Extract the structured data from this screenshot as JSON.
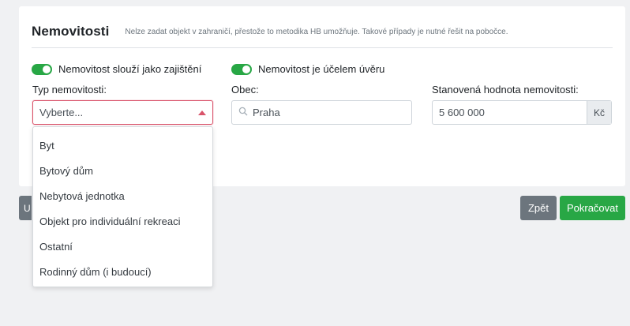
{
  "card": {
    "title": "Nemovitosti",
    "note": "Nelze zadat objekt v zahraničí, přestože to metodika HB umožňuje. Takové případy je nutné řešit na pobočce."
  },
  "toggles": [
    {
      "label": "Nemovitost slouží jako zajištění",
      "on": true
    },
    {
      "label": "Nemovitost je účelem úvěru",
      "on": true
    }
  ],
  "fields": {
    "type": {
      "label": "Typ nemovitosti:",
      "value": "Vyberte..."
    },
    "city": {
      "label": "Obec:",
      "value": "Praha",
      "icon": "search-icon"
    },
    "value": {
      "label": "Stanovená hodnota nemovitosti:",
      "value": "5 600 000",
      "unit": "Kč"
    }
  },
  "dropdown": {
    "options": [
      "Byt",
      "Bytový dům",
      "Nebytová jednotka",
      "Objekt pro individuální rekreaci",
      "Ostatní",
      "Rodinný dům (i budoucí)"
    ]
  },
  "buttons": {
    "partial": "U",
    "back": "Zpět",
    "next": "Pokračovat"
  },
  "colors": {
    "accent_green": "#28a745",
    "secondary_gray": "#6c757d",
    "invalid_red": "#d9536a"
  }
}
